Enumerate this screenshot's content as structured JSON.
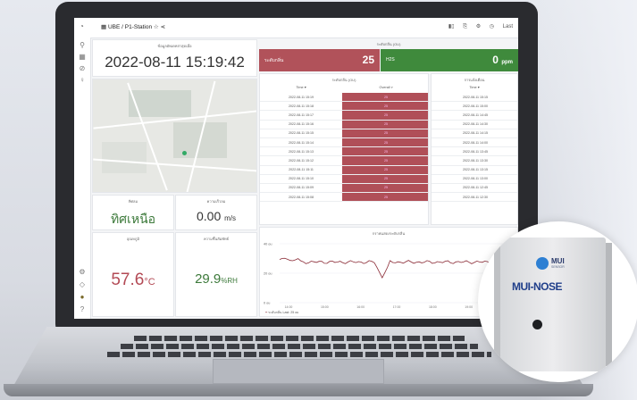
{
  "breadcrumb": "UBE / P1-Station",
  "topbar_icons": [
    "bar-chart-icon",
    "save-icon",
    "gear-icon",
    "clock-icon"
  ],
  "topbar_right_text": "Last",
  "panels": {
    "datetime": {
      "title": "ข้อมูลอัพเดทล่าสุดเมื่อ",
      "value": "2022-08-11 15:19:42"
    },
    "direction": {
      "title": "ทิศลม",
      "value": "ทิศเหนือ"
    },
    "wind_speed": {
      "title": "ความเร็วลม",
      "value": "0.00",
      "unit": "m/s"
    },
    "temperature": {
      "title": "อุณหภูมิ",
      "value": "57.6",
      "unit": "°C"
    },
    "humidity": {
      "title": "ความชื้นสัมพัทธ์",
      "value": "29.9",
      "unit": "%RH"
    },
    "odor_header": "ระดับกลิ่น (OU)",
    "odor_stat": {
      "label": "ระดับกลิ่น",
      "value": "25"
    },
    "h2s_stat": {
      "label": "H2S",
      "value": "0",
      "unit": "ppm"
    },
    "odor_table": {
      "title": "ระดับกลิ่น (OU)",
      "col_time": "Time",
      "col_overall": "Overall",
      "rows": [
        {
          "time": "2022-08-11 15:19",
          "value": "25"
        },
        {
          "time": "2022-08-11 15:18",
          "value": "25"
        },
        {
          "time": "2022-08-11 15:17",
          "value": "25"
        },
        {
          "time": "2022-08-11 15:16",
          "value": "25"
        },
        {
          "time": "2022-08-11 15:15",
          "value": "25"
        },
        {
          "time": "2022-08-11 15:14",
          "value": "25"
        },
        {
          "time": "2022-08-11 15:13",
          "value": "25"
        },
        {
          "time": "2022-08-11 15:12",
          "value": "25"
        },
        {
          "time": "2022-08-11 15:11",
          "value": "25"
        },
        {
          "time": "2022-08-11 15:10",
          "value": "25"
        },
        {
          "time": "2022-08-11 15:09",
          "value": "25"
        },
        {
          "time": "2022-08-11 15:08",
          "value": "25"
        }
      ]
    },
    "right_table": {
      "title": "การแจ้งเตือน",
      "col_time": "Time",
      "rows": [
        "2022-08-11 15:15",
        "2022-08-11 15:00",
        "2022-08-11 14:45",
        "2022-08-11 14:30",
        "2022-08-11 14:15",
        "2022-08-11 14:00",
        "2022-08-11 13:45",
        "2022-08-11 13:30",
        "2022-08-11 13:15",
        "2022-08-11 13:00",
        "2022-08-11 12:45",
        "2022-08-11 12:30"
      ]
    },
    "trend": {
      "title": "กราฟแสดงระดับกลิ่น",
      "y_ticks": [
        "40 ou",
        "20 ou",
        "0 ou"
      ],
      "x_ticks": [
        "14:00",
        "15:00",
        "16:00",
        "17:00",
        "18:00",
        "19:00",
        "20:00"
      ],
      "legend": "ระดับกลิ่น",
      "legend_last": "Last: 25 ou"
    }
  },
  "device": {
    "brand": "MUI",
    "brand_sub": "SENSOR",
    "name": "MUI-NOSE"
  },
  "colors": {
    "odor_red": "#b1525a",
    "h2s_green": "#3f8a3c",
    "accent_blue": "#2d7fd3"
  }
}
